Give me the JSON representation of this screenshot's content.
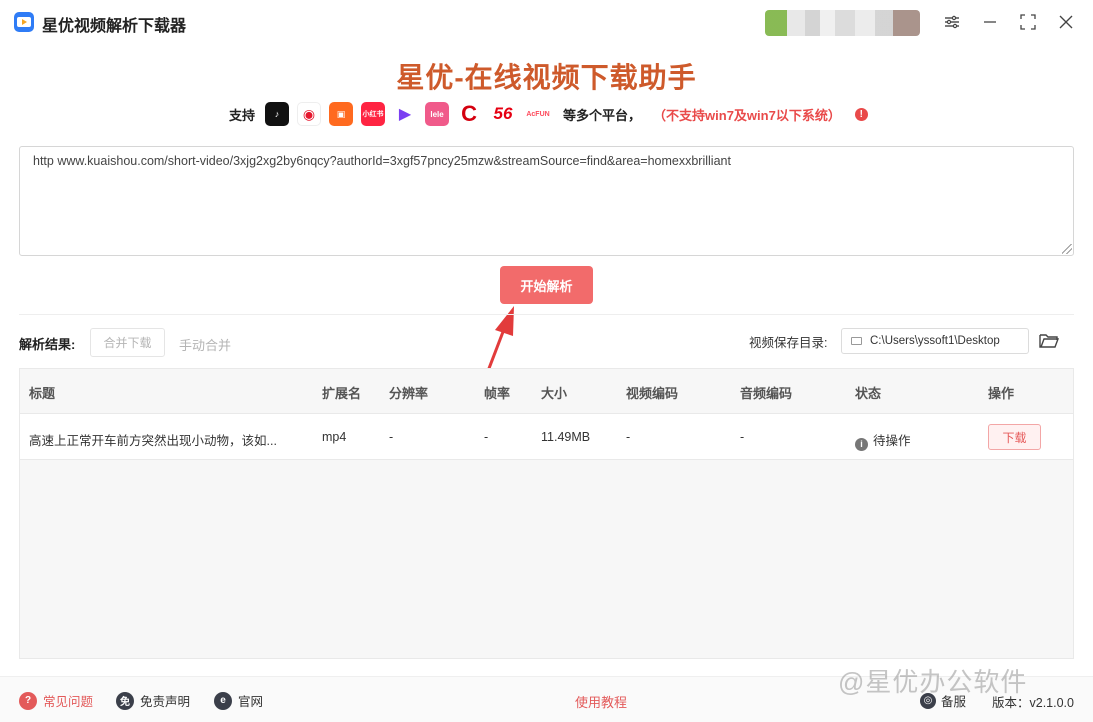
{
  "app": {
    "title": "星优视频解析下载器"
  },
  "brand": {
    "headline": "星优-在线视频下载助手"
  },
  "platforms": {
    "prefix": "支持",
    "icons": [
      {
        "name": "tiktok-icon",
        "glyph": "♪"
      },
      {
        "name": "weibo-icon",
        "glyph": "◉"
      },
      {
        "name": "kuaishou-icon",
        "glyph": "▣"
      },
      {
        "name": "xiaohongshu-icon",
        "glyph": "小红书"
      },
      {
        "name": "play-icon",
        "glyph": "▶"
      },
      {
        "name": "lele-icon",
        "glyph": "lele"
      },
      {
        "name": "c-logo-icon",
        "glyph": "C"
      },
      {
        "name": "56-logo-icon",
        "glyph": "56"
      },
      {
        "name": "acfun-icon",
        "glyph": "AcFUN"
      }
    ],
    "more": "等多个平台，",
    "warning": "（不支持win7及win7以下系统）"
  },
  "input": {
    "url": "http www.kuaishou.com/short-video/3xjg2xg2by6nqcy?authorId=3xgf57pncy25mzw&streamSource=find&area=homexxbrilliant"
  },
  "actions": {
    "start": "开始解析"
  },
  "results": {
    "label": "解析结果:",
    "merge_download": "合并下载",
    "manual_merge": "手动合并",
    "save_dir_label": "视频保存目录:",
    "save_dir_value": "C:\\Users\\yssoft1\\Desktop"
  },
  "table": {
    "headers": [
      "标题",
      "扩展名",
      "分辨率",
      "帧率",
      "大小",
      "视频编码",
      "音频编码",
      "状态",
      "操作"
    ],
    "rows": [
      {
        "title": "高速上正常开车前方突然出现小动物，该如...",
        "ext": "mp4",
        "resolution": "-",
        "fps": "-",
        "size": "11.49MB",
        "video_codec": "-",
        "audio_codec": "-",
        "status": "待操作",
        "action": "下载"
      }
    ]
  },
  "footer": {
    "faq": "常见问题",
    "disclaimer": "免责声明",
    "official": "官网",
    "tutorial": "使用教程",
    "backup": "备服",
    "version": "版本：v2.1.0.0"
  },
  "watermark": "@星优办公软件",
  "colors": {
    "accent": "#f26b6b",
    "brand": "#ce5a2b",
    "warning": "#e94a4a"
  }
}
